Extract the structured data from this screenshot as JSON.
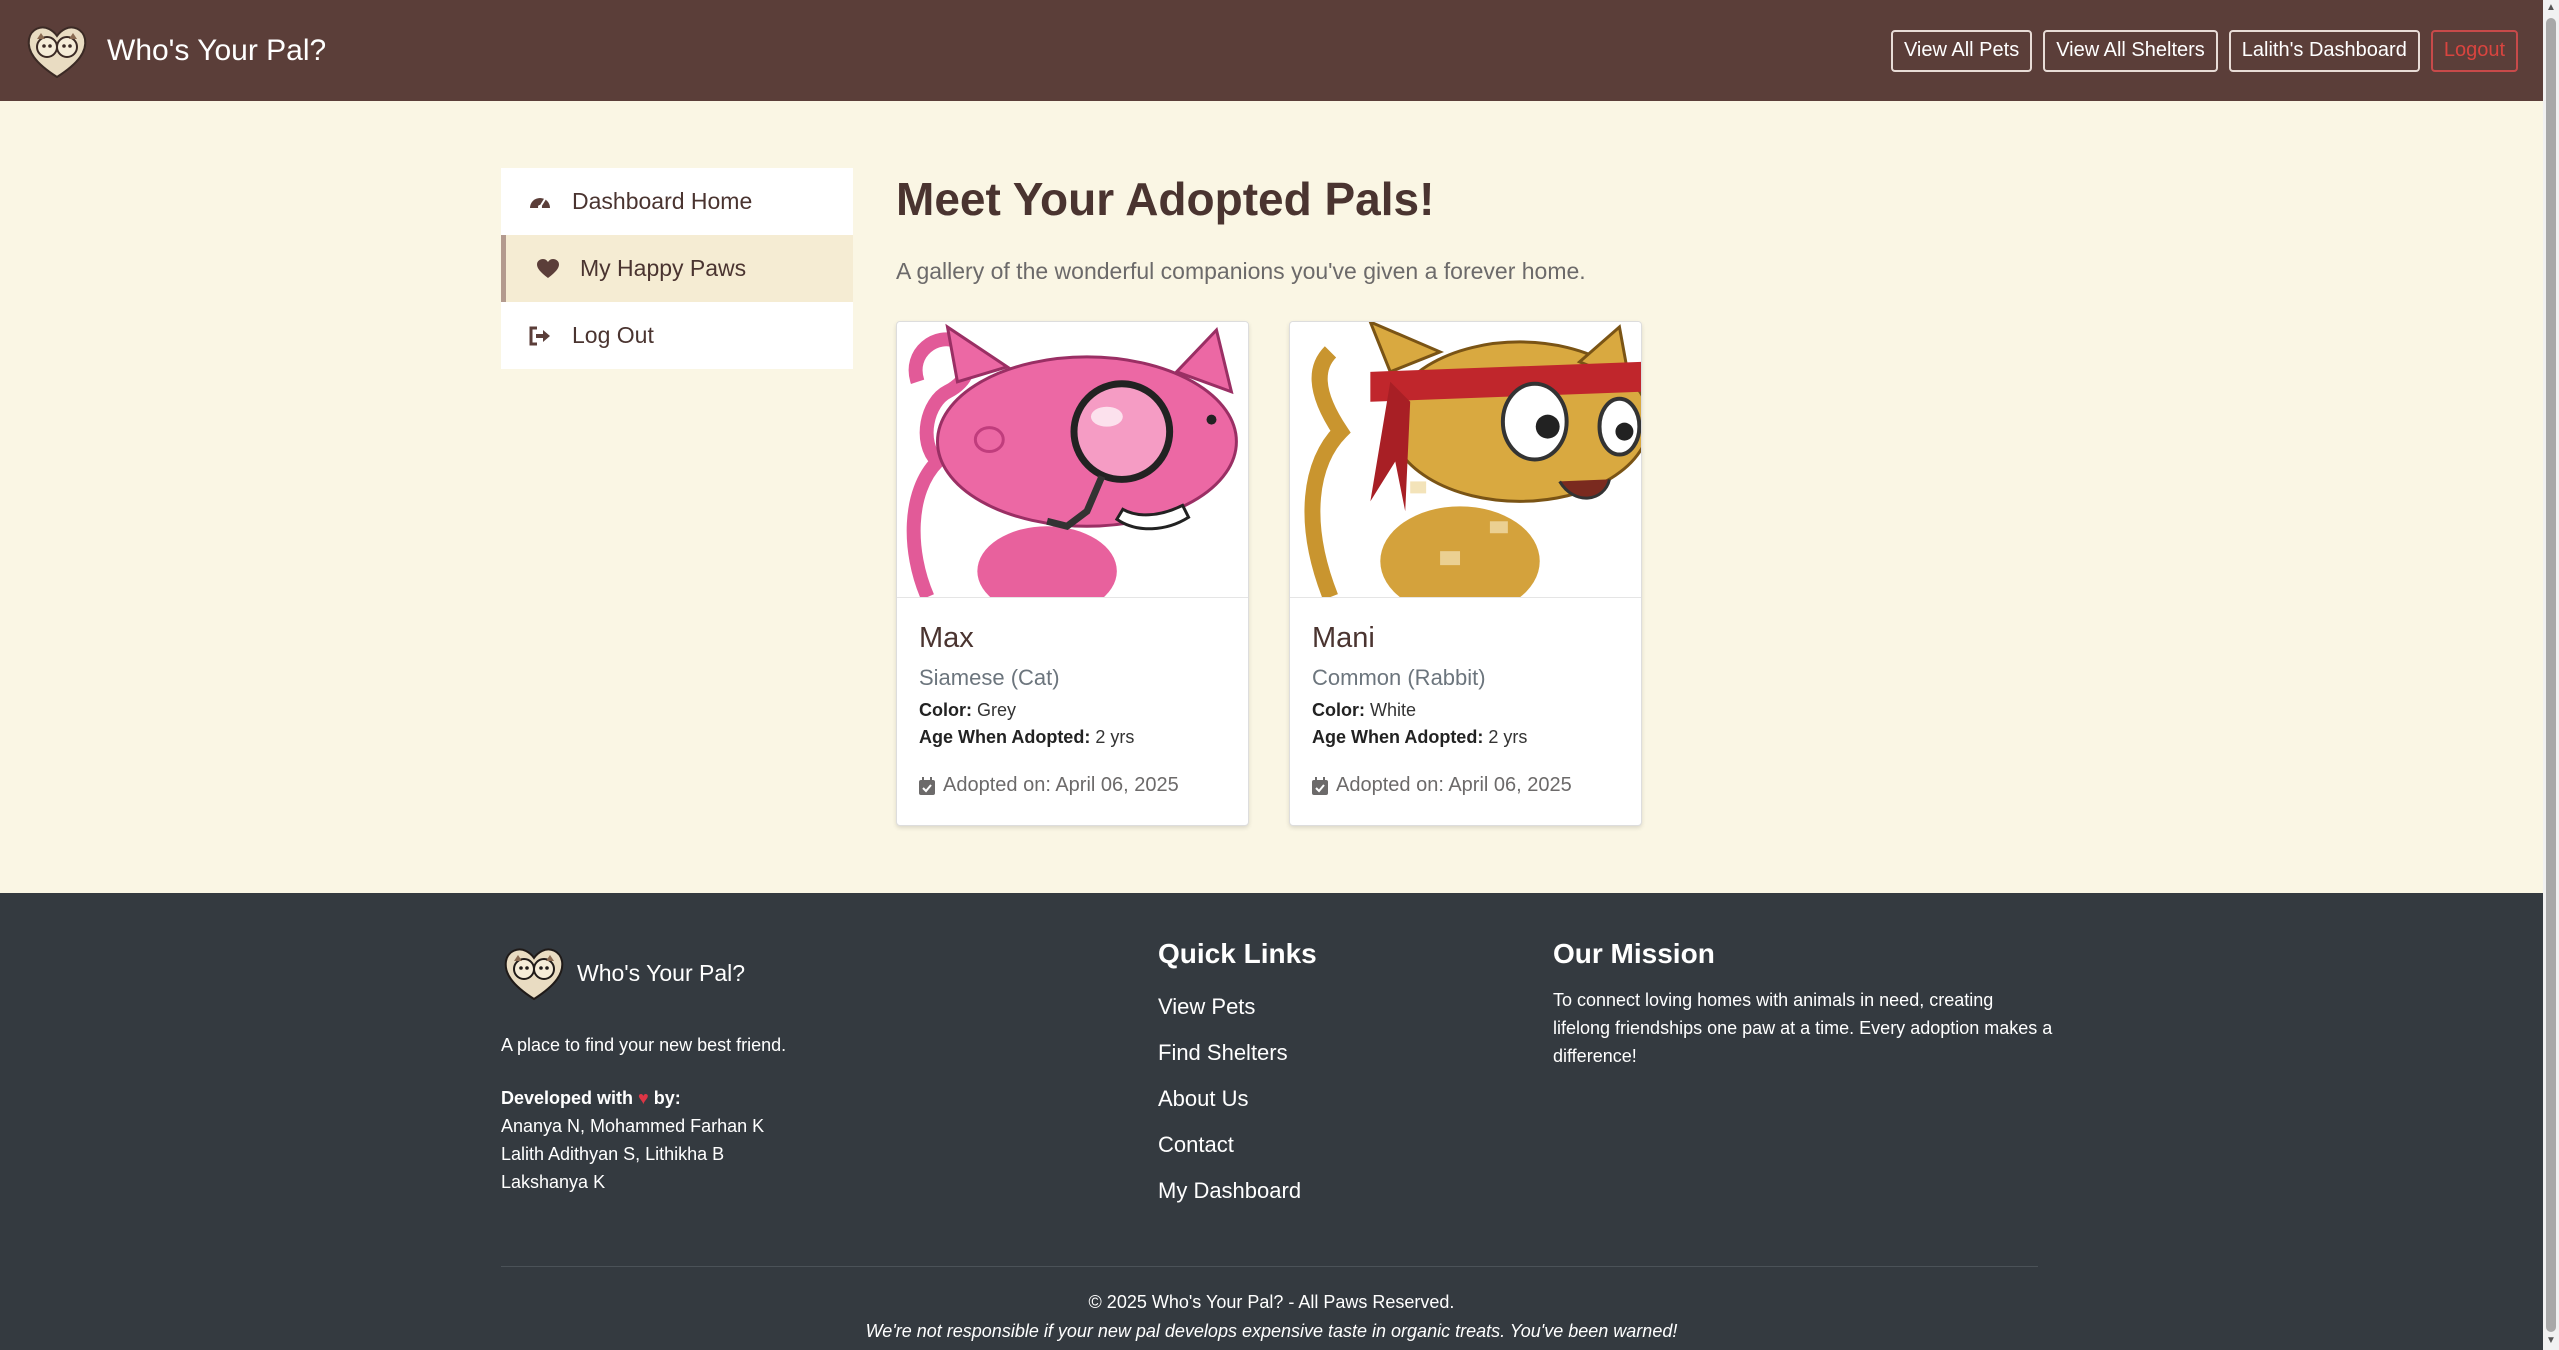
{
  "navbar": {
    "brand": "Who's Your Pal?",
    "buttons": [
      "View All Pets",
      "View All Shelters",
      "Lalith's Dashboard"
    ],
    "logout": "Logout"
  },
  "sidebar": {
    "items": [
      {
        "label": "Dashboard Home",
        "icon": "dashboard-gauge-icon"
      },
      {
        "label": "My Happy Paws",
        "icon": "heart-icon",
        "active": true
      },
      {
        "label": "Log Out",
        "icon": "sign-out-icon"
      }
    ]
  },
  "main": {
    "title": "Meet Your Adopted Pals!",
    "subtitle": "A gallery of the wonderful companions you've given a forever home.",
    "pets": [
      {
        "name": "Max",
        "breed": "Siamese (Cat)",
        "color_label": "Color:",
        "color": "Grey",
        "age_label": "Age When Adopted:",
        "age": "2 yrs",
        "adopted": "Adopted on: April 06, 2025",
        "image": "pink-cartoon-cat-with-magnifying-glass"
      },
      {
        "name": "Mani",
        "breed": "Common (Rabbit)",
        "color_label": "Color:",
        "color": "White",
        "age_label": "Age When Adopted:",
        "age": "2 yrs",
        "adopted": "Adopted on: April 06, 2025",
        "image": "orange-cartoon-cat-with-red-headband"
      }
    ]
  },
  "footer": {
    "brand": "Who's Your Pal?",
    "tagline": "A place to find your new best friend.",
    "developed_prefix": "Developed with",
    "developed_suffix": "by:",
    "developers": [
      "Ananya N, Mohammed Farhan K",
      "Lalith Adithyan S, Lithikha B",
      "Lakshanya K"
    ],
    "quick_links_heading": "Quick Links",
    "quick_links": [
      "View Pets",
      "Find Shelters",
      "About Us",
      "Contact",
      "My Dashboard"
    ],
    "mission_heading": "Our Mission",
    "mission": "To connect loving homes with animals in need, creating lifelong friendships one paw at a time. Every adoption makes a difference!",
    "copyright": "© 2025 Who's Your Pal? - All Paws Reserved.",
    "warning": "We're not responsible if your new pal develops expensive taste in organic treats. You've been warned!"
  },
  "colors": {
    "navbar": "#5b3e39",
    "page_bg": "#faf6e4",
    "footer": "#343a40",
    "logout": "#d9443f",
    "heart": "#dc3545"
  }
}
